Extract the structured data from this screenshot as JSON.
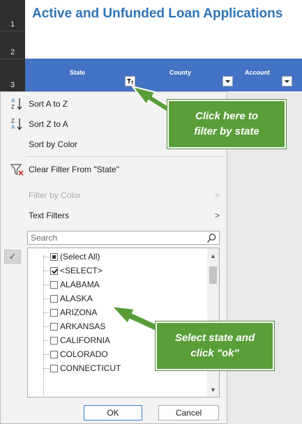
{
  "sheet": {
    "title": "Active and Unfunded Loan Applications",
    "row_numbers": [
      "1",
      "2",
      "3"
    ],
    "columns": [
      "State",
      "County",
      "Account"
    ]
  },
  "filter_menu": {
    "sort_a_z": "Sort A to Z",
    "sort_z_a": "Sort Z to A",
    "sort_by_color": "Sort by Color",
    "clear_filter": "Clear Filter From \"State\"",
    "filter_by_color": "Filter by Color",
    "text_filters": "Text Filters",
    "search_placeholder": "Search",
    "items": [
      {
        "label": "(Select All)",
        "state": "partial"
      },
      {
        "label": "<SELECT>",
        "state": "checked"
      },
      {
        "label": "ALABAMA",
        "state": "unchecked"
      },
      {
        "label": "ALASKA",
        "state": "unchecked"
      },
      {
        "label": "ARIZONA",
        "state": "unchecked"
      },
      {
        "label": "ARKANSAS",
        "state": "unchecked"
      },
      {
        "label": "CALIFORNIA",
        "state": "unchecked"
      },
      {
        "label": "COLORADO",
        "state": "unchecked"
      },
      {
        "label": "CONNECTICUT",
        "state": "unchecked"
      }
    ],
    "ok_label": "OK",
    "cancel_label": "Cancel"
  },
  "annotations": {
    "callout_1": "Click here to\nfilter by state",
    "callout_2": "Select state and\nclick \"ok\""
  },
  "colors": {
    "header_blue": "#4472c4",
    "title_blue": "#2e74b5",
    "callout_green": "#5a9e3a"
  },
  "icons": {
    "sort_a_z": "sort-ascending-icon",
    "sort_z_a": "sort-descending-icon",
    "clear_filter": "clear-filter-icon",
    "search": "search-icon",
    "filter_active": "filter-funnel-icon",
    "dropdown": "chevron-down-icon"
  }
}
